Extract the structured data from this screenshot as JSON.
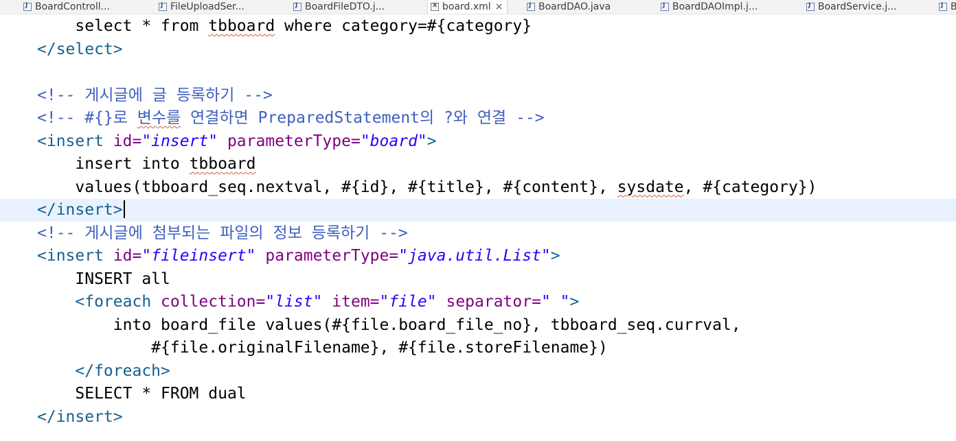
{
  "tabs": [
    {
      "label": "BoardControll...",
      "icon": "java-file-icon"
    },
    {
      "label": "FileUploadSer...",
      "icon": "java-file-icon"
    },
    {
      "label": "BoardFileDTO.j...",
      "icon": "java-file-icon"
    },
    {
      "label": "board.xml",
      "icon": "xml-file-icon",
      "active": true,
      "close": "×"
    },
    {
      "label": "BoardDAO.java",
      "icon": "java-file-icon"
    },
    {
      "label": "BoardDAOImpl.j...",
      "icon": "java-file-icon"
    },
    {
      "label": "BoardService.j...",
      "icon": "java-file-icon"
    },
    {
      "label": "B",
      "icon": "java-file-icon"
    }
  ],
  "editor": {
    "file": "board.xml",
    "lines": [
      {
        "indent": "    ",
        "parts": [
          {
            "t": "select * from ",
            "k": "plain"
          },
          {
            "t": "tbboard",
            "k": "plain",
            "sq": true
          },
          {
            "t": " where category=#{category}",
            "k": "plain"
          }
        ]
      },
      {
        "indent": "",
        "parts": [
          {
            "t": "</select>",
            "k": "tag"
          }
        ]
      },
      {
        "indent": "",
        "parts": []
      },
      {
        "indent": "",
        "parts": [
          {
            "t": "<!-- 게시글에 글 등록하기 -->",
            "k": "cmt"
          }
        ]
      },
      {
        "indent": "",
        "parts": [
          {
            "t": "<!-- #{}로 ",
            "k": "cmt"
          },
          {
            "t": "변수를",
            "k": "cmt",
            "sq": true
          },
          {
            "t": " 연결하면 PreparedStatement의 ?와 연결 -->",
            "k": "cmt"
          }
        ]
      },
      {
        "indent": "",
        "parts": [
          {
            "t": "<insert ",
            "k": "tag"
          },
          {
            "t": "id=",
            "k": "attr"
          },
          {
            "t": "\"insert\"",
            "k": "val"
          },
          {
            "t": " parameterType=",
            "k": "attr"
          },
          {
            "t": "\"board\"",
            "k": "val"
          },
          {
            "t": ">",
            "k": "tag"
          }
        ]
      },
      {
        "indent": "    ",
        "parts": [
          {
            "t": "insert into ",
            "k": "plain"
          },
          {
            "t": "tbboard",
            "k": "plain",
            "sq": true
          }
        ]
      },
      {
        "indent": "    ",
        "parts": [
          {
            "t": "values(tbboard_seq.nextval, #{id}, #{title}, #{content}, ",
            "k": "plain"
          },
          {
            "t": "sysdate",
            "k": "plain",
            "sq": true
          },
          {
            "t": ", #{category})",
            "k": "plain"
          }
        ]
      },
      {
        "indent": "",
        "current": true,
        "caret": true,
        "parts": [
          {
            "t": "</insert>",
            "k": "tag"
          }
        ]
      },
      {
        "indent": "",
        "parts": [
          {
            "t": "<!-- 게시글에 첨부되는 파일의 정보 등록하기 -->",
            "k": "cmt"
          }
        ]
      },
      {
        "indent": "",
        "parts": [
          {
            "t": "<insert ",
            "k": "tag"
          },
          {
            "t": "id=",
            "k": "attr"
          },
          {
            "t": "\"fileinsert\"",
            "k": "val"
          },
          {
            "t": " parameterType=",
            "k": "attr"
          },
          {
            "t": "\"java.util.List\"",
            "k": "val"
          },
          {
            "t": ">",
            "k": "tag"
          }
        ]
      },
      {
        "indent": "    ",
        "parts": [
          {
            "t": "INSERT all",
            "k": "plain"
          }
        ]
      },
      {
        "indent": "    ",
        "parts": [
          {
            "t": "<foreach ",
            "k": "tag"
          },
          {
            "t": "collection=",
            "k": "attr"
          },
          {
            "t": "\"list\"",
            "k": "val"
          },
          {
            "t": " item=",
            "k": "attr"
          },
          {
            "t": "\"file\"",
            "k": "val"
          },
          {
            "t": " separator=",
            "k": "attr"
          },
          {
            "t": "\" \"",
            "k": "val"
          },
          {
            "t": ">",
            "k": "tag"
          }
        ]
      },
      {
        "indent": "        ",
        "parts": [
          {
            "t": "into board_file values(#{file.board_file_no}, tbboard_seq.currval,",
            "k": "plain"
          }
        ]
      },
      {
        "indent": "            ",
        "parts": [
          {
            "t": "#{file.originalFilename}, #{file.storeFilename})",
            "k": "plain"
          }
        ]
      },
      {
        "indent": "    ",
        "parts": [
          {
            "t": "</foreach>",
            "k": "tag"
          }
        ]
      },
      {
        "indent": "    ",
        "parts": [
          {
            "t": "SELECT * FROM dual",
            "k": "plain"
          }
        ]
      },
      {
        "indent": "",
        "parts": [
          {
            "t": "</insert>",
            "k": "tag"
          }
        ]
      }
    ]
  },
  "colors": {
    "tag": "#17608f",
    "attribute": "#7f007f",
    "attribute_value": "#2a00ff",
    "comment": "#3f5fbf",
    "current_line": "#e8f2fe",
    "spell_squiggle": "#d05c3c"
  }
}
